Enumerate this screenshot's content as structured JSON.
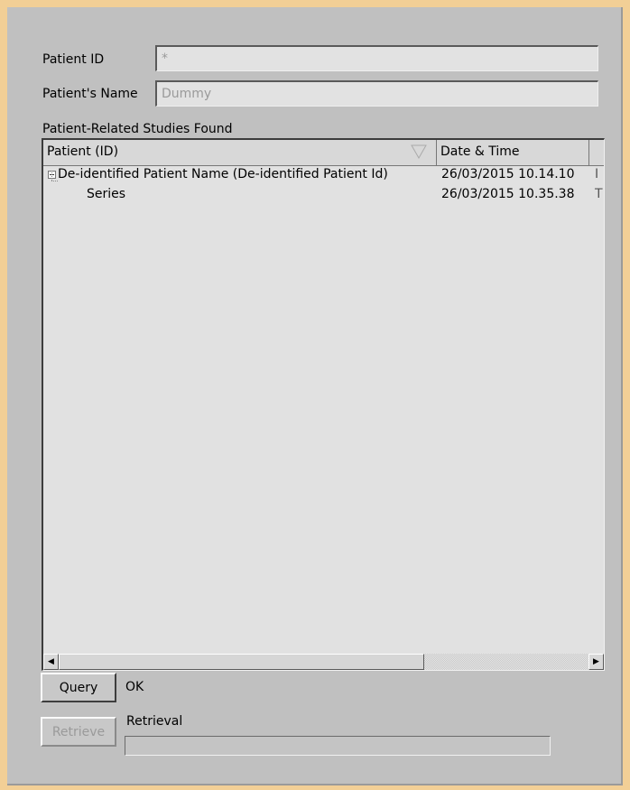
{
  "form": {
    "patient_id_label": "Patient ID",
    "patient_id_value": "*",
    "patient_name_label": "Patient's Name",
    "patient_name_placeholder": "Dummy"
  },
  "studies": {
    "section_label": "Patient-Related Studies Found",
    "columns": [
      "Patient (ID)",
      "Date & Time"
    ],
    "rows": [
      {
        "name": "De-identified Patient Name (De-identified Patient Id)",
        "datetime": "26/03/2015 10.14.10",
        "overflow": "I",
        "expanded": true
      },
      {
        "name": "Series",
        "datetime": "26/03/2015 10.35.38",
        "overflow": "T"
      }
    ]
  },
  "actions": {
    "query_label": "Query",
    "query_status": "OK",
    "retrieve_label": "Retrieve",
    "retrieval_label": "Retrieval",
    "retrieval_progress": 0
  },
  "icons": {
    "sort": "sort-descending-icon",
    "expander": "tree-collapse-icon",
    "scroll_left": "◀",
    "scroll_right": "▶"
  }
}
